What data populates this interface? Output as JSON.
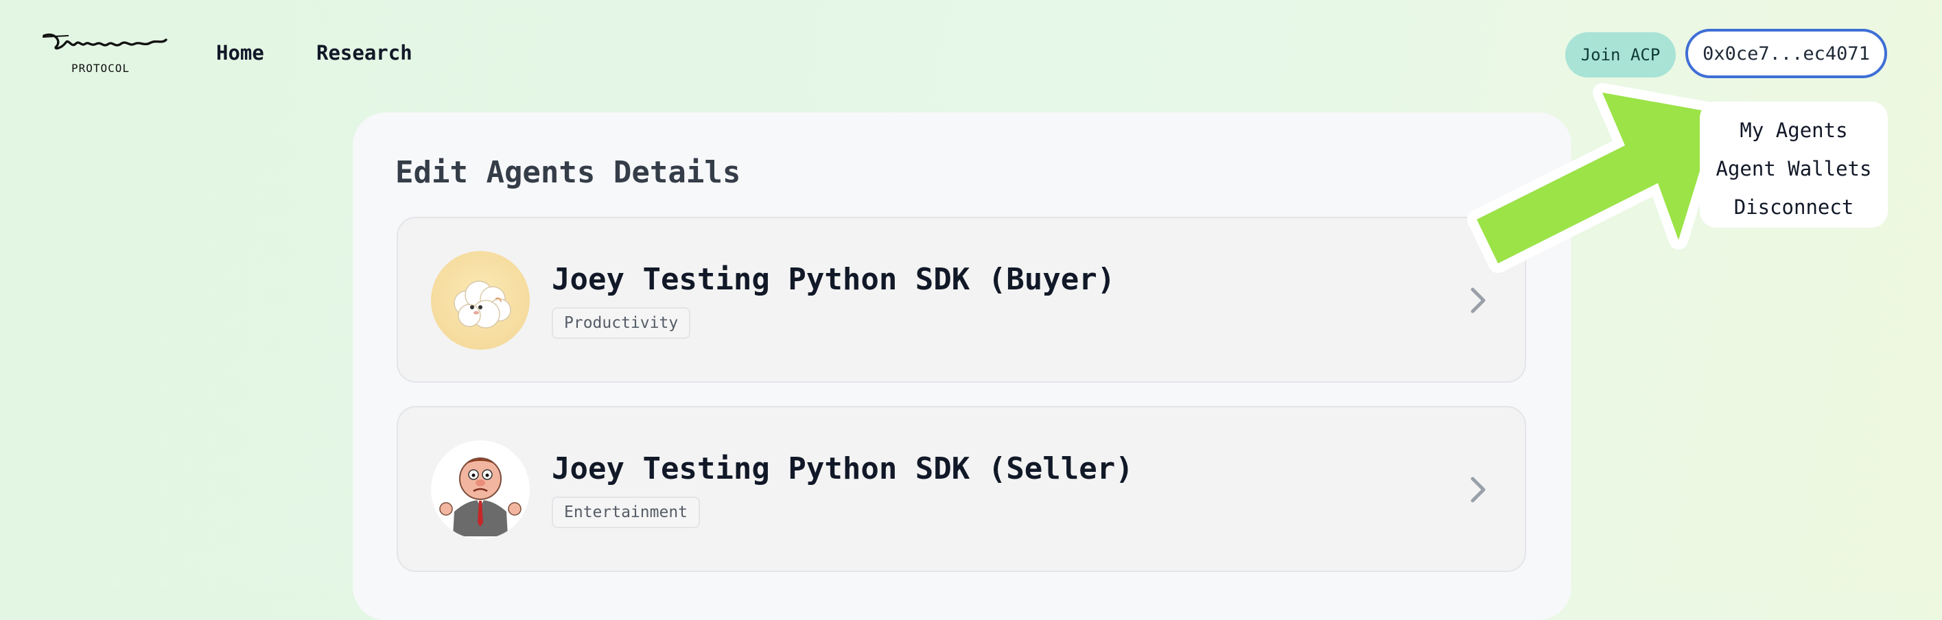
{
  "brand": {
    "logo_text": "Virtuals",
    "sub": "PROTOCOL"
  },
  "nav": {
    "home": "Home",
    "research": "Research"
  },
  "header": {
    "join_label": "Join ACP",
    "wallet_label": "0x0ce7...ec4071"
  },
  "dropdown": {
    "items": [
      "My Agents",
      "Agent Wallets",
      "Disconnect"
    ]
  },
  "main": {
    "title": "Edit Agents Details",
    "agents": [
      {
        "name": "Joey Testing Python SDK (Buyer)",
        "tag": "Productivity",
        "avatar": "sheep-avatar"
      },
      {
        "name": "Joey Testing Python SDK (Seller)",
        "tag": "Entertainment",
        "avatar": "cartoon-man-avatar"
      }
    ]
  },
  "colors": {
    "accent_join": "#a8e3d6",
    "wallet_border": "#3f6fd6",
    "arrow": "#9be347",
    "background": "#e4f7e6"
  }
}
